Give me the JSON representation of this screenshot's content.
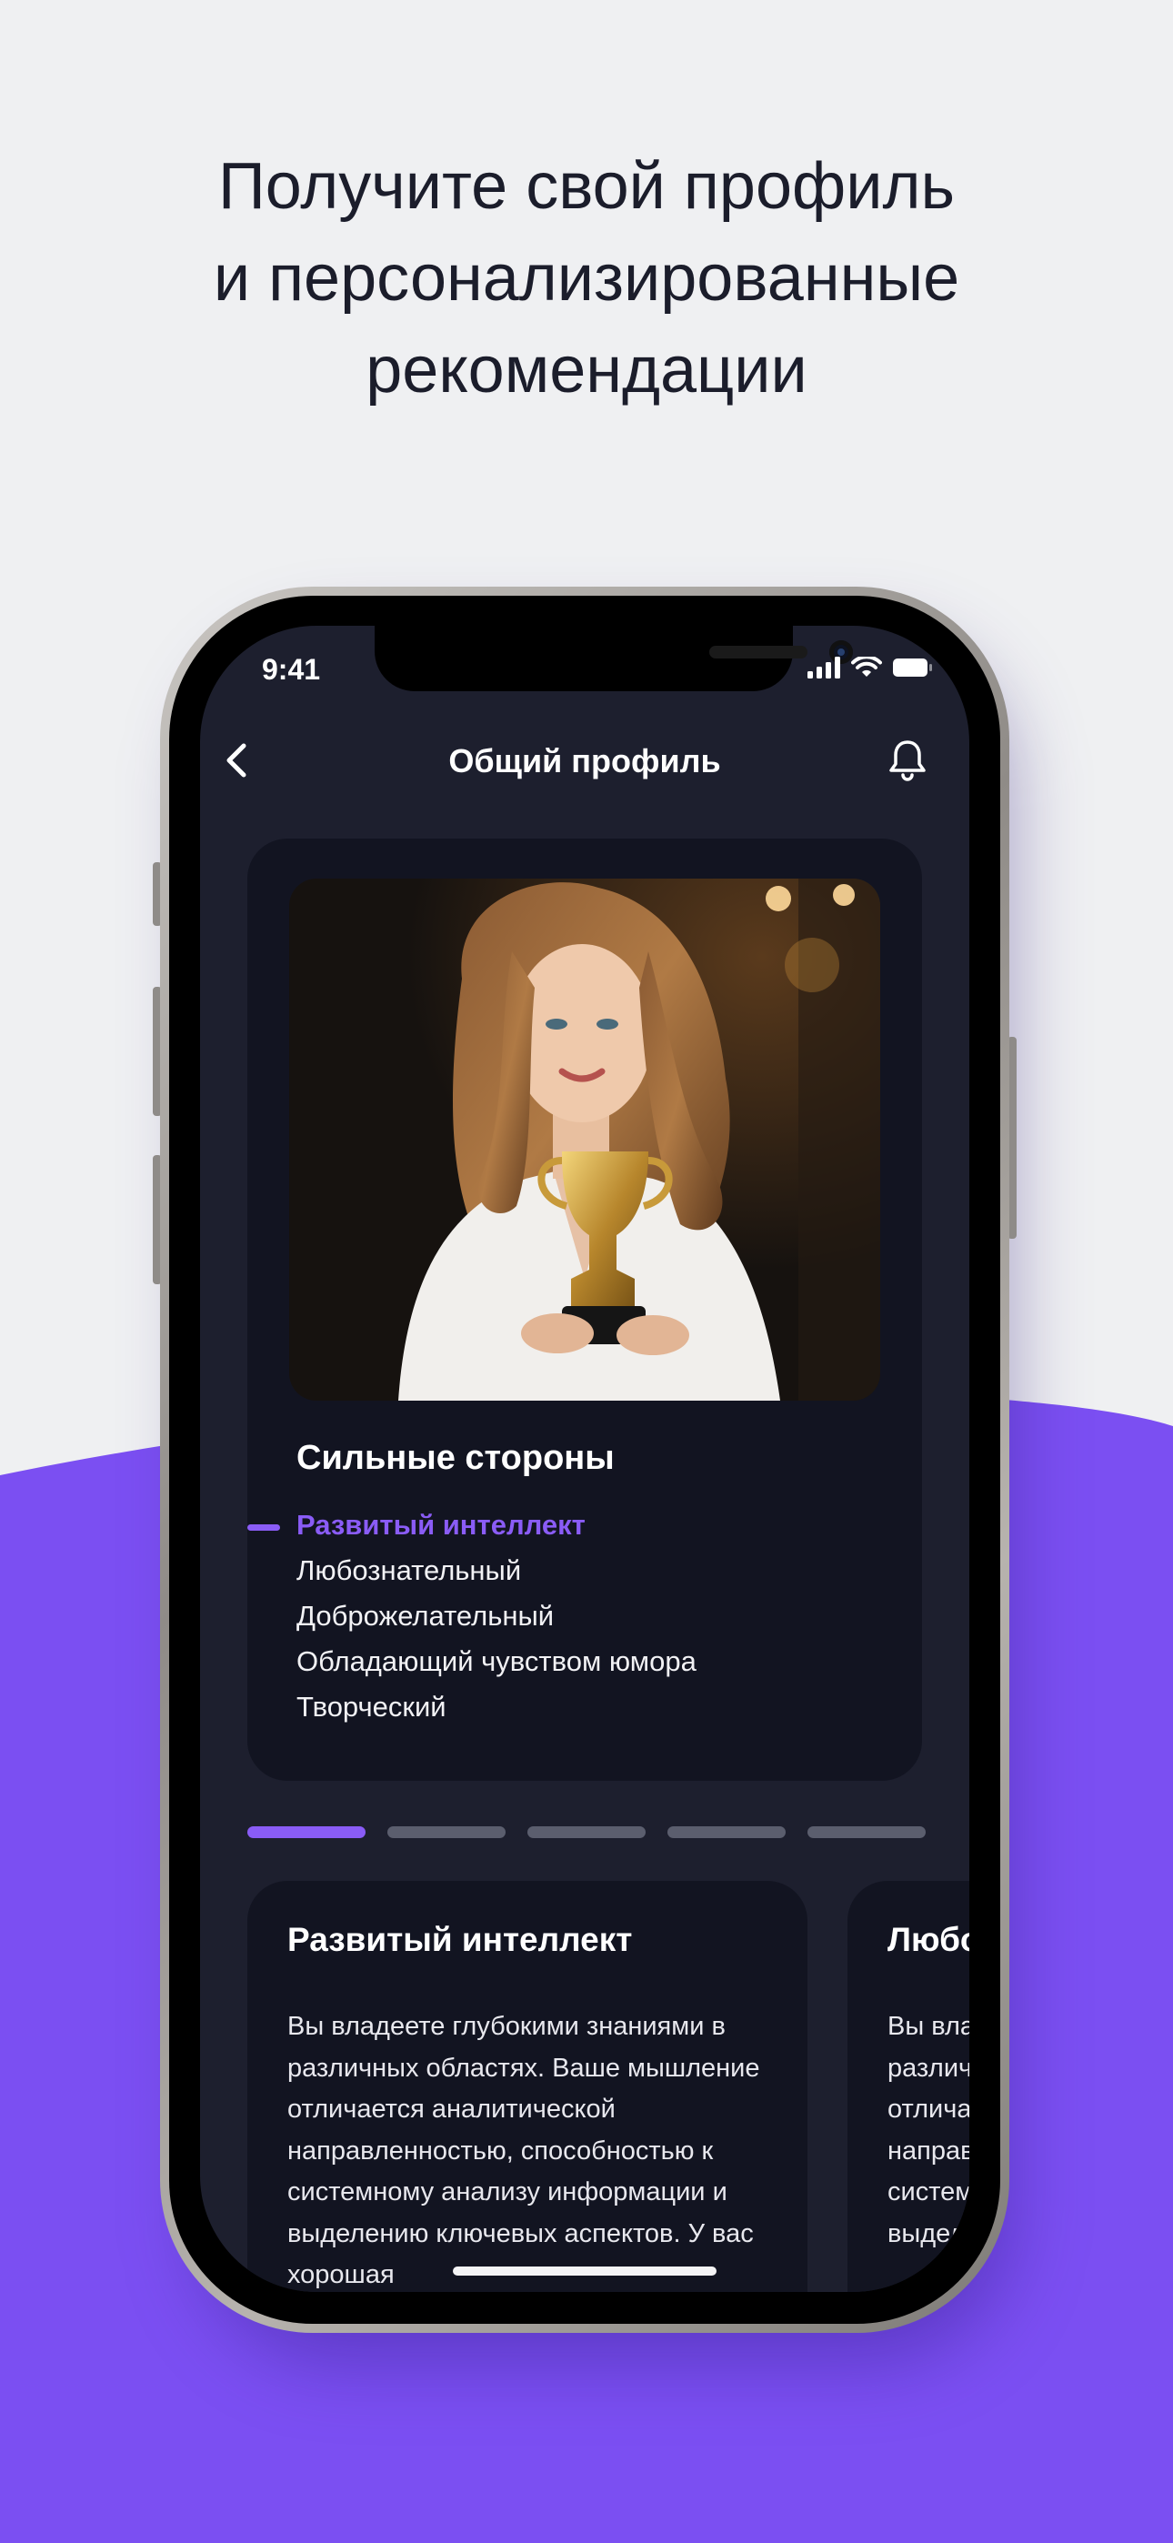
{
  "headline": {
    "line1": "Получите свой профиль",
    "line2": "и персонализированные",
    "line3": "рекомендации"
  },
  "colors": {
    "accent": "#8a5cf6",
    "background": "#eff0f2",
    "purple_band": "#7b4ff2",
    "app_bg": "#1d1f2e",
    "card_bg": "#121421"
  },
  "status_bar": {
    "time": "9:41",
    "icons": [
      "signal-icon",
      "wifi-icon",
      "battery-icon"
    ]
  },
  "nav": {
    "title": "Общий профиль",
    "back_icon": "chevron-left-icon",
    "bell_icon": "bell-icon"
  },
  "profile_card": {
    "image": "portrait-with-trophy",
    "title": "Сильные стороны",
    "strengths": [
      "Развитый интеллект",
      "Любознательный",
      "Доброжелательный",
      "Обладающий чувством юмора",
      "Творческий"
    ],
    "active_index": 0
  },
  "pager": {
    "count": 5,
    "active": 0
  },
  "detail_cards": [
    {
      "title": "Развитый интеллект",
      "text": "Вы владеете глубокими знаниями в различных областях. Ваше мышление отличается аналитической направленностью, способностью к системному анализу информации и выделению ключевых аспектов. У вас хорошая"
    },
    {
      "title": "Любознательный",
      "text": "Вы владеете глубокими знаниями в различных областях. Ваше мышление отличается аналитической направленностью, способностью к системному анализу информации и выделению ключевых аспектов."
    }
  ]
}
